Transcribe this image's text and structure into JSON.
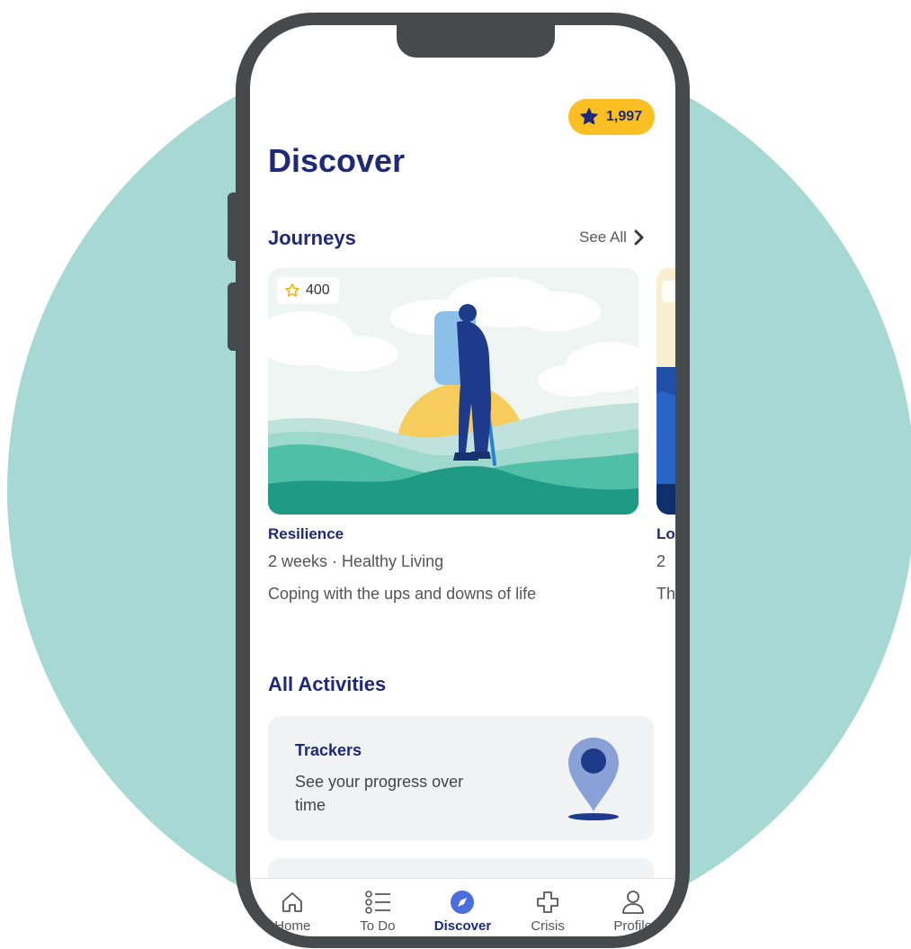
{
  "header": {
    "title": "Discover",
    "points": "1,997"
  },
  "journeys": {
    "section_title": "Journeys",
    "see_all_label": "See All",
    "cards": [
      {
        "points": "400",
        "name": "Resilience",
        "meta": "2 weeks · Healthy Living",
        "description": "Coping with the ups and downs of life"
      },
      {
        "name_partial": "Lo",
        "meta_partial": "2",
        "description_partial": "Th"
      }
    ]
  },
  "activities": {
    "section_title": "All Activities",
    "items": [
      {
        "title": "Trackers",
        "description": "See your progress over time",
        "icon": "location-pin-icon"
      }
    ]
  },
  "tab_bar": {
    "items": [
      {
        "label": "Home",
        "icon": "home-icon"
      },
      {
        "label": "To Do",
        "icon": "checklist-icon"
      },
      {
        "label": "Discover",
        "icon": "compass-icon",
        "active": true
      },
      {
        "label": "Crisis",
        "icon": "medical-cross-icon"
      },
      {
        "label": "Profile",
        "icon": "user-icon"
      }
    ]
  },
  "colors": {
    "brand": "#1e2a78",
    "points_badge": "#fbbf24",
    "background_circle": "#a6d9d4",
    "phone_frame": "#464a4c"
  }
}
